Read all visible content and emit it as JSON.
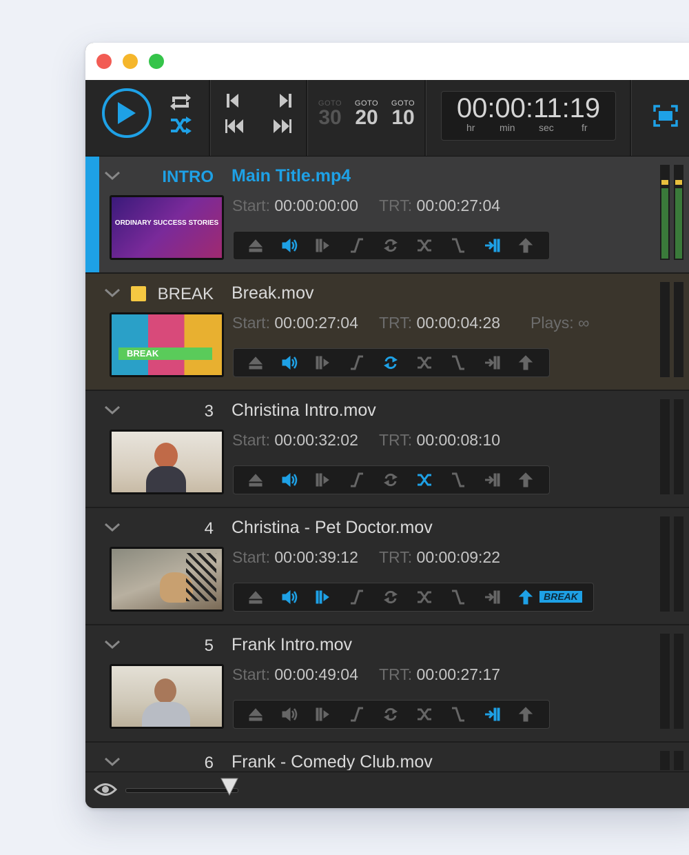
{
  "colors": {
    "accent": "#1ea1e6",
    "break_swatch": "#f5c842",
    "vu_green": "#3a7a3a",
    "vu_yellow": "#e7bf3e"
  },
  "toolbar": {
    "goto": [
      {
        "label": "GOTO",
        "value": "30",
        "dim": true
      },
      {
        "label": "GOTO",
        "value": "20",
        "dim": false
      },
      {
        "label": "GOTO",
        "value": "10",
        "dim": false
      }
    ],
    "timecode": "00:00:11:19",
    "timecode_units": {
      "hr": "hr",
      "min": "min",
      "sec": "sec",
      "fr": "fr"
    },
    "icons": [
      "play-icon",
      "repeat-icon",
      "shuffle-icon",
      "prev-icon",
      "next-icon",
      "rewind-icon",
      "fast-forward-icon",
      "fullscreen-icon"
    ]
  },
  "clips": [
    {
      "number": "INTRO",
      "name": "Main Title.mp4",
      "start_label": "Start:",
      "start": "00:00:00:00",
      "trt_label": "TRT:",
      "trt": "00:00:27:04",
      "plays": "",
      "thumb_text": "ORDINARY SUCCESS STORIES"
    },
    {
      "number": "BREAK",
      "name": "Break.mov",
      "start_label": "Start:",
      "start": "00:00:27:04",
      "trt_label": "TRT:",
      "trt": "00:00:04:28",
      "plays_label": "Plays:",
      "plays": "∞",
      "thumb_text": "BREAK"
    },
    {
      "number": "3",
      "name": "Christina Intro.mov",
      "start_label": "Start:",
      "start": "00:00:32:02",
      "trt_label": "TRT:",
      "trt": "00:00:08:10"
    },
    {
      "number": "4",
      "name": "Christina - Pet Doctor.mov",
      "start_label": "Start:",
      "start": "00:00:39:12",
      "trt_label": "TRT:",
      "trt": "00:00:09:22",
      "badge": "BREAK"
    },
    {
      "number": "5",
      "name": "Frank Intro.mov",
      "start_label": "Start:",
      "start": "00:00:49:04",
      "trt_label": "TRT:",
      "trt": "00:00:27:17"
    },
    {
      "number": "6",
      "name": "Frank - Comedy Club.mov"
    }
  ],
  "bottom": {
    "icons": [
      "eye-icon",
      "slider-knob-icon"
    ],
    "thumb_size_level": 0.9
  }
}
